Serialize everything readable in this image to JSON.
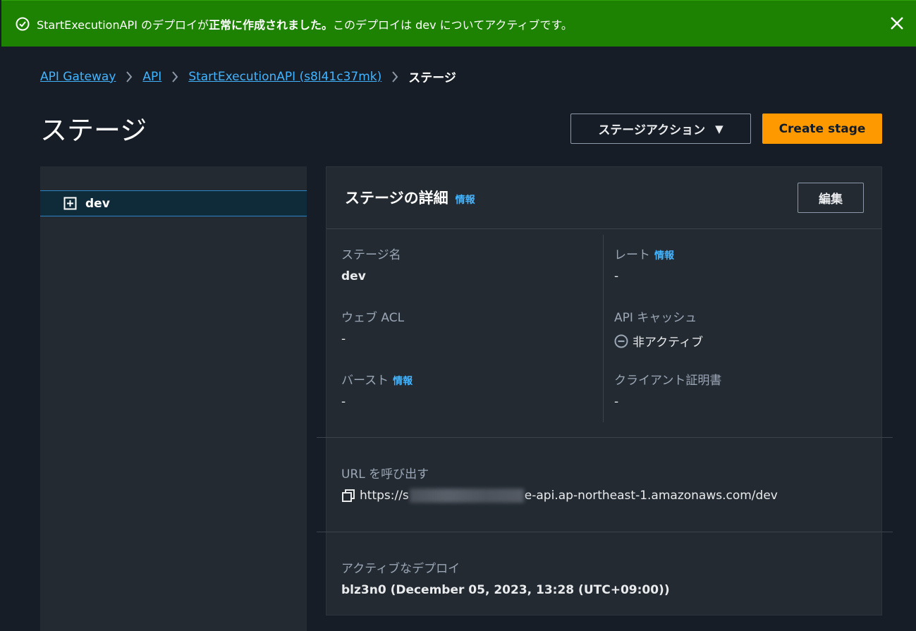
{
  "flash": {
    "message_prefix": "StartExecutionAPI のデプロイが",
    "message_bold": "正常に作成されました。",
    "message_suffix": "このデプロイは dev についてアクティブです。"
  },
  "breadcrumb": {
    "items": [
      "API Gateway",
      "API",
      "StartExecutionAPI (s8l41c37mk)"
    ],
    "current": "ステージ"
  },
  "page": {
    "title": "ステージ",
    "actions_label": "ステージアクション",
    "create_label": "Create stage"
  },
  "tree": {
    "items": [
      {
        "label": "dev"
      }
    ]
  },
  "details": {
    "title": "ステージの詳細",
    "info_label": "情報",
    "edit_label": "編集",
    "fields": {
      "stage_name": {
        "label": "ステージ名",
        "value": "dev"
      },
      "web_acl": {
        "label": "ウェブ ACL",
        "value": "-"
      },
      "burst": {
        "label": "バースト",
        "info": "情報",
        "value": "-"
      },
      "rate": {
        "label": "レート",
        "info": "情報",
        "value": "-"
      },
      "api_cache": {
        "label": "API キャッシュ",
        "value": "非アクティブ"
      },
      "client_cert": {
        "label": "クライアント証明書",
        "value": "-"
      }
    },
    "invoke_url": {
      "label": "URL を呼び出す",
      "prefix": "https://s",
      "suffix": "e-api.ap-northeast-1.amazonaws.com/dev"
    },
    "active_deployment": {
      "label": "アクティブなデプロイ",
      "value": "blz3n0 (December 05, 2023, 13:28 (UTC+09:00))"
    }
  },
  "colors": {
    "success": "#1d8102",
    "primary": "#ff9900",
    "link": "#42b4ff",
    "background": "#161d26",
    "panel": "#232a32"
  }
}
